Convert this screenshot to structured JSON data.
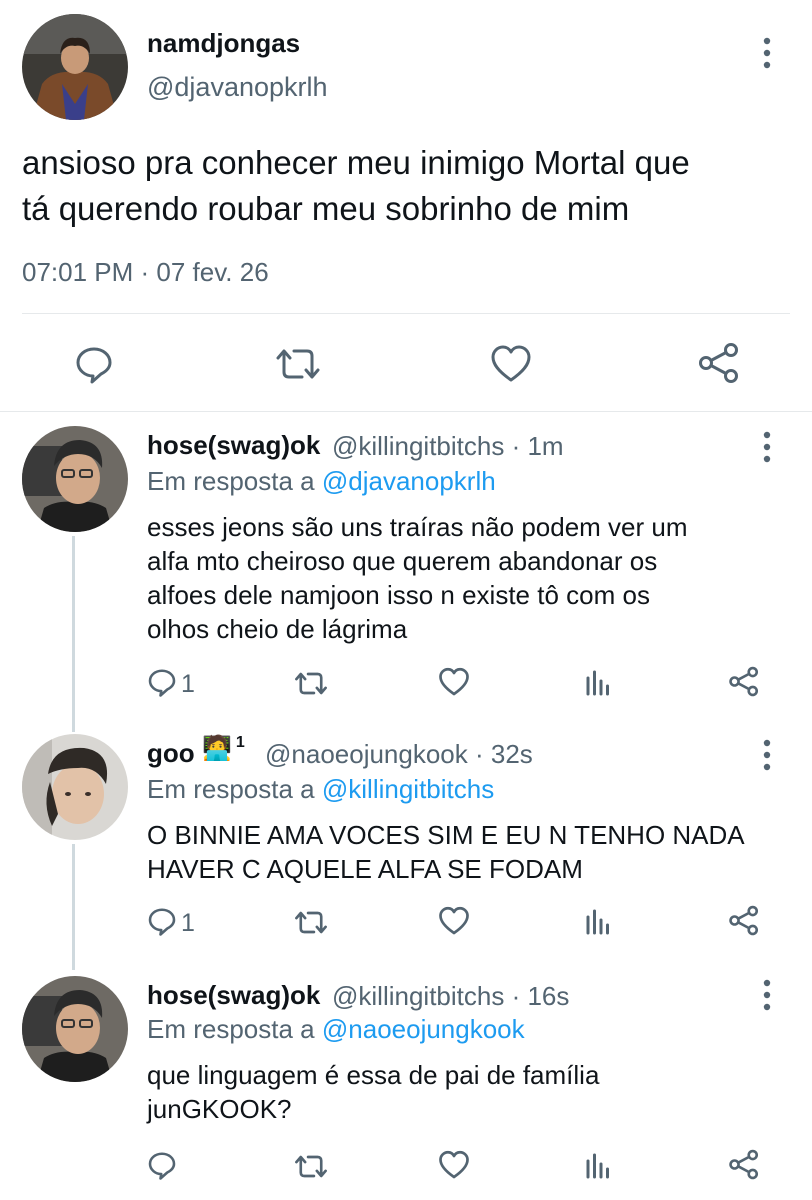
{
  "main_tweet": {
    "display_name": "namdjongas",
    "handle": "@djavanopkrlh",
    "text_line1": "ansioso pra conhecer meu inimigo Mortal que",
    "text_line2": "tá querendo roubar meu sobrinho de mim",
    "timestamp": "07:01 PM · 07 fev. 26"
  },
  "replies": [
    {
      "display_name": "hose(swag)ok",
      "handle_time": "@killingitbitchs · 1m",
      "reply_prefix": "Em resposta a",
      "reply_to": "@djavanopkrlh",
      "lines": [
        "esses jeons são uns traíras não podem ver um",
        "alfa mto cheiroso que querem abandonar os",
        "alfoes dele namjoon isso n existe tô com os",
        "olhos cheio de lágrima"
      ],
      "reply_count": "1"
    },
    {
      "display_name": "goo",
      "badge_emoji": "🧑‍💻",
      "badge_count": "1",
      "handle_time": "@naoeojungkook · 32s",
      "reply_prefix": "Em resposta a",
      "reply_to": "@killingitbitchs",
      "lines": [
        "O BINNIE AMA VOCES SIM E EU N TENHO NADA",
        "HAVER C AQUELE ALFA SE FODAM"
      ],
      "reply_count": "1"
    },
    {
      "display_name": "hose(swag)ok",
      "handle_time": "@killingitbitchs · 16s",
      "reply_prefix": "Em resposta a",
      "reply_to": "@naoeojungkook",
      "lines": [
        "que linguagem é essa de pai de família",
        "junGKOOK?"
      ],
      "reply_count": ""
    }
  ],
  "colors": {
    "text": "#0f1419",
    "secondary": "#536471",
    "link": "#1d9bf0",
    "divider": "#e6e9eb",
    "thread_line": "#cfd9de"
  },
  "icons": [
    "reply-icon",
    "retweet-icon",
    "like-icon",
    "share-icon",
    "analytics-icon",
    "more-icon"
  ]
}
